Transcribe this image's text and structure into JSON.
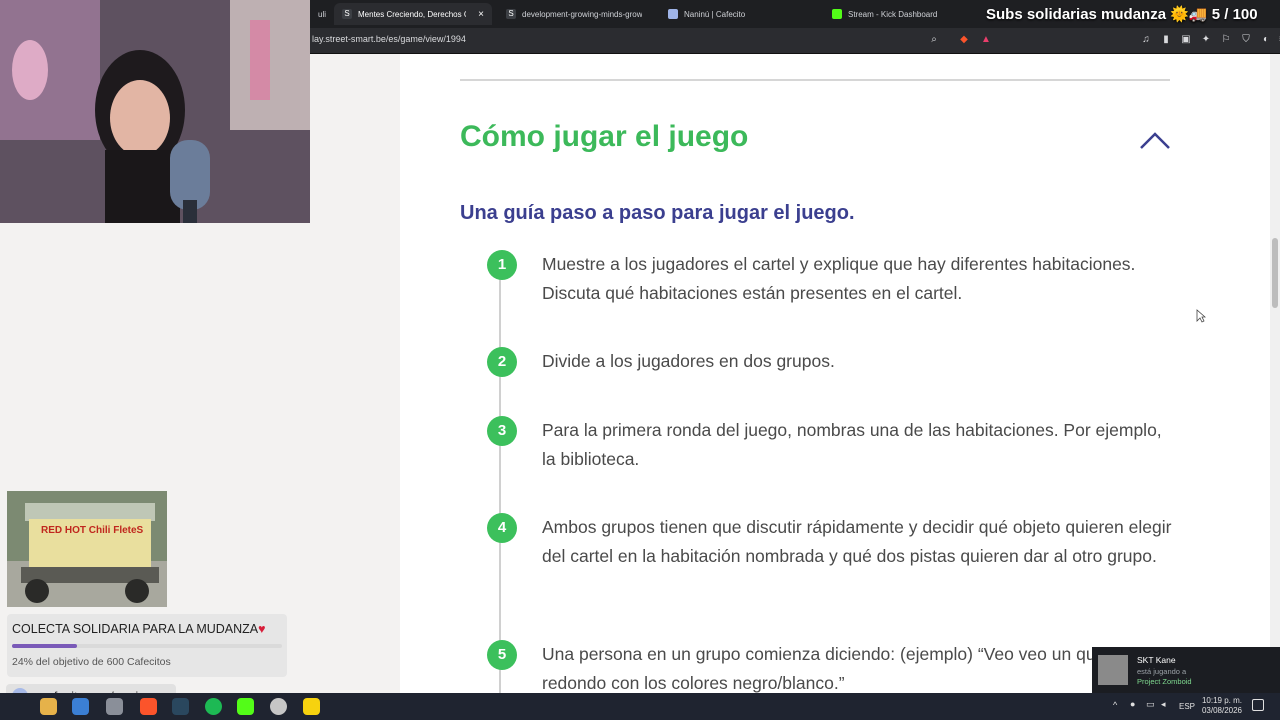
{
  "browser": {
    "tabs": [
      {
        "label": "uli",
        "active": false
      },
      {
        "label": "Mentes Creciendo, Derechos Cre",
        "active": true
      },
      {
        "label": "development-growing-minds-growin",
        "active": false
      },
      {
        "label": "Naninú | Cafecito",
        "active": false
      },
      {
        "label": "Stream - Kick Dashboard",
        "active": false
      }
    ],
    "address": "lay.street-smart.be/es/game/view/1994"
  },
  "overlay": {
    "subs_banner": "Subs solidarias mudanza 🌞🚚 5 / 100",
    "truck_sign": "RED HOT Chili FleteS"
  },
  "page": {
    "section_title": "Cómo jugar el juego",
    "subtitle": "Una guía paso a paso para jugar el juego.",
    "steps": [
      {
        "num": "1",
        "text": "Muestre a los jugadores el cartel y explique que hay diferentes habitaciones. Discuta qué habitaciones están presentes en el cartel."
      },
      {
        "num": "2",
        "text": "Divide a los jugadores en dos grupos."
      },
      {
        "num": "3",
        "text": "Para la primera ronda del juego, nombras una de las habitaciones. Por ejemplo, la biblioteca."
      },
      {
        "num": "4",
        "text": "Ambos grupos tienen que discutir rápidamente y decidir qué objeto quieren elegir del cartel en la habitación nombrada y qué dos pistas quieren dar al otro grupo."
      },
      {
        "num": "5",
        "text": "Una persona en un grupo comienza diciendo: (ejemplo) “Veo veo un que es redondo con los colores negro/blanco.”"
      }
    ]
  },
  "donation": {
    "title": "COLECTA SOLIDARIA PARA LA MUDANZA",
    "subtitle": "24% del objetivo de 600 Cafecitos",
    "progress": 0.24,
    "link": "cafecito.app/naninu_"
  },
  "notification": {
    "name": "SKT Kane",
    "status": "está jugando a",
    "game": "Project Zomboid"
  },
  "taskbar": {
    "lang": "ESP",
    "time": "10:19 p. m.",
    "date": "03/08/2026"
  },
  "colors": {
    "green": "#3cb95a",
    "purple_subtitle": "#3b3f8f",
    "progress": "#7a5ab8"
  }
}
